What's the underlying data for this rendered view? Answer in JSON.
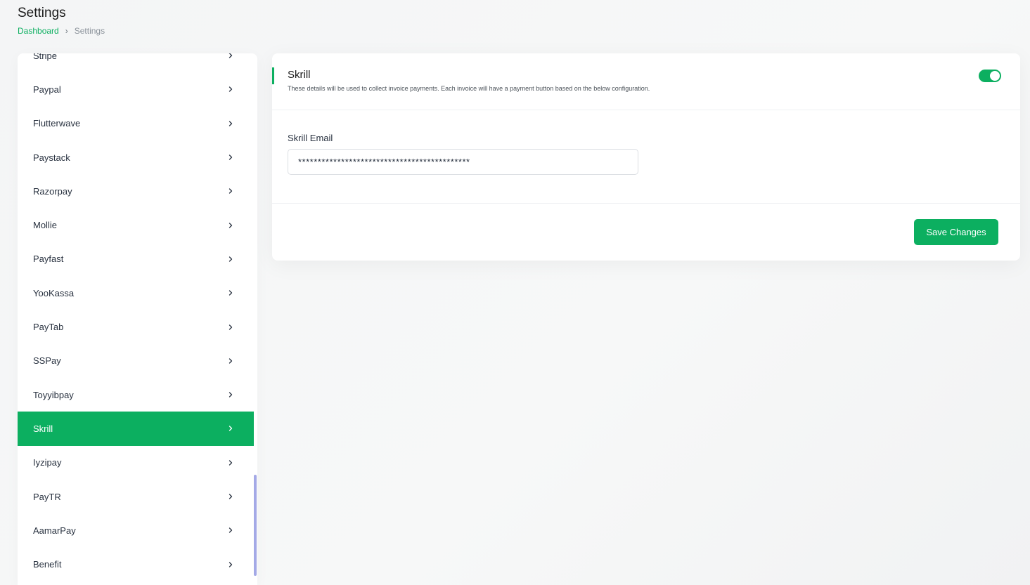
{
  "header": {
    "title": "Settings",
    "breadcrumb": {
      "home": "Dashboard",
      "separator": "›",
      "current": "Settings"
    }
  },
  "sidebar": {
    "items": [
      {
        "label": "Stripe",
        "active": false
      },
      {
        "label": "Paypal",
        "active": false
      },
      {
        "label": "Flutterwave",
        "active": false
      },
      {
        "label": "Paystack",
        "active": false
      },
      {
        "label": "Razorpay",
        "active": false
      },
      {
        "label": "Mollie",
        "active": false
      },
      {
        "label": "Payfast",
        "active": false
      },
      {
        "label": "YooKassa",
        "active": false
      },
      {
        "label": "PayTab",
        "active": false
      },
      {
        "label": "SSPay",
        "active": false
      },
      {
        "label": "Toyyibpay",
        "active": false
      },
      {
        "label": "Skrill",
        "active": true
      },
      {
        "label": "Iyzipay",
        "active": false
      },
      {
        "label": "PayTR",
        "active": false
      },
      {
        "label": "AamarPay",
        "active": false
      },
      {
        "label": "Benefit",
        "active": false
      }
    ]
  },
  "card": {
    "title": "Skrill",
    "description": "These details will be used to collect invoice payments. Each invoice will have a payment button based on the below configuration.",
    "enabled": true,
    "field_label": "Skrill Email",
    "field_value": "********************************************",
    "save_label": "Save Changes"
  },
  "colors": {
    "accent": "#0caf60",
    "scrollbar": "#a4a9e6"
  },
  "icons": {
    "chevron": "chevron-right-icon"
  }
}
